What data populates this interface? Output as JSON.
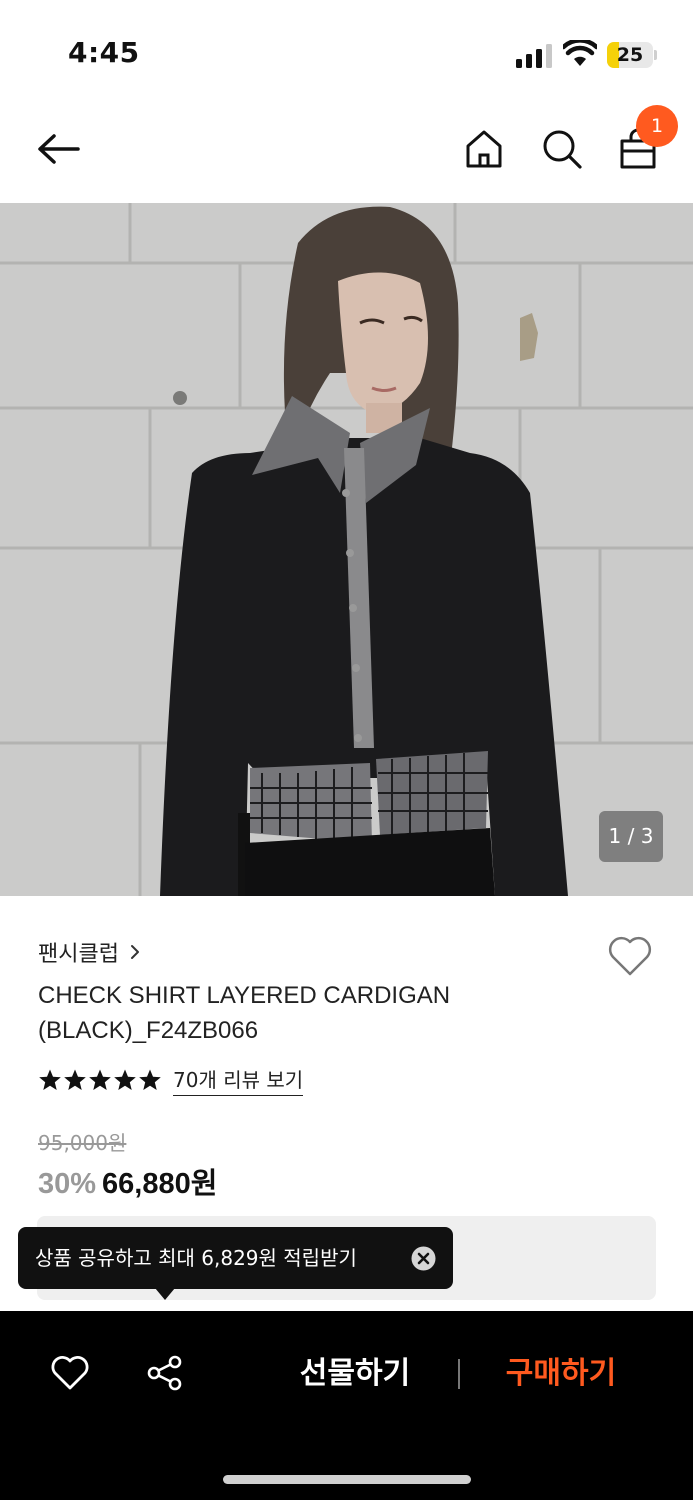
{
  "status_bar": {
    "time": "4:45",
    "battery": "25",
    "battery_fraction": 0.25,
    "battery_color": "#f5d10a"
  },
  "header": {
    "back_icon": "arrow-left-icon",
    "home_icon": "home-icon",
    "search_icon": "search-icon",
    "cart_icon": "shopping-bag-icon",
    "cart_badge": "1",
    "badge_color": "#ff5a1f"
  },
  "gallery": {
    "counter": "1 / 3"
  },
  "product": {
    "brand": "팬시클럽",
    "title": "CHECK SHIRT LAYERED CARDIGAN (BLACK)_F24ZB066",
    "rating_stars": 5,
    "review_link": "70개 리뷰 보기",
    "original_price": "95,000원",
    "discount": "30%",
    "price": "66,880원"
  },
  "tooltip": {
    "text": "상품 공유하고 최대 6,829원 적립받기"
  },
  "bottom_bar": {
    "gift_label": "선물하기",
    "buy_label": "구매하기",
    "accent_color": "#ff5a1f"
  }
}
